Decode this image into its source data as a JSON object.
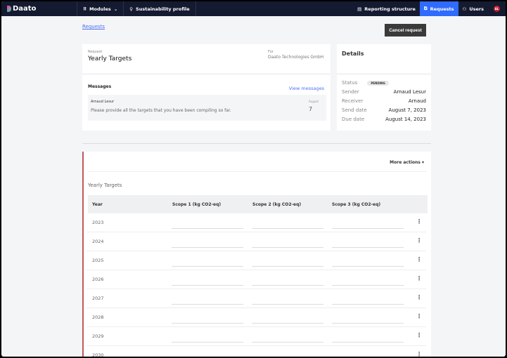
{
  "nav": {
    "brand": "Daato",
    "modules": "Modules",
    "sustainability": "Sustainability profile",
    "reporting": "Reporting structure",
    "requests": "Requests",
    "users": "Users",
    "avatar": "AL"
  },
  "breadcrumb": "Requests",
  "cancel_label": "Cancel request",
  "request": {
    "label": "Request",
    "title": "Yearly Targets",
    "for_label": "For",
    "for_value": "Daato Technologies GmbH"
  },
  "messages": {
    "title": "Messages",
    "view": "View messages",
    "items": [
      {
        "sender": "Arnaud Lesur",
        "text": "Please provide all the targets that you have been compiling so far.",
        "month": "August",
        "day": "7"
      }
    ]
  },
  "details": {
    "title": "Details",
    "status_label": "Status",
    "status": "PENDING",
    "rows": [
      {
        "label": "Sender",
        "value": "Arnaud Lesur"
      },
      {
        "label": "Receiver",
        "value": "Arnaud"
      },
      {
        "label": "Send date",
        "value": "August 7, 2023"
      },
      {
        "label": "Due date",
        "value": "August 14, 2023"
      }
    ]
  },
  "table": {
    "more_actions": "More actions",
    "title": "Yearly Targets",
    "headers": [
      "Year",
      "Scope 1 (kg CO2-eq)",
      "Scope 2 (kg CO2-eq)",
      "Scope 3 (kg CO2-eq)"
    ],
    "years": [
      "2023",
      "2024",
      "2025",
      "2026",
      "2027",
      "2028",
      "2029",
      "2030"
    ]
  }
}
